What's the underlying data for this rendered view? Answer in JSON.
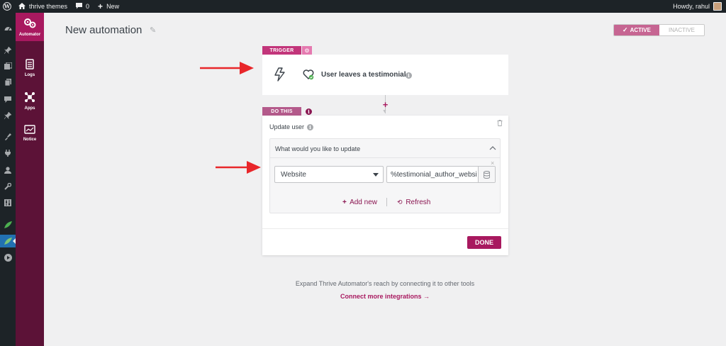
{
  "adminbar": {
    "site_name": "thrive themes",
    "comments_count": "0",
    "new_label": "New",
    "howdy": "Howdy, rahul"
  },
  "sidebar": {
    "items": [
      {
        "label": "Automator",
        "icon": "automator-icon"
      },
      {
        "label": "Logs",
        "icon": "logs-icon"
      },
      {
        "label": "Apps",
        "icon": "apps-icon"
      },
      {
        "label": "Notice",
        "icon": "notice-icon"
      }
    ]
  },
  "header": {
    "title": "New automation",
    "status_active": "ACTIVE",
    "status_inactive": "INACTIVE"
  },
  "trigger": {
    "badge": "TRIGGER",
    "label": "User leaves a testimonial"
  },
  "action": {
    "badge": "DO THIS",
    "name": "Update user",
    "panel_title": "What would you like to update",
    "field_select": "Website",
    "field_value": "%testimonial_author_website%",
    "add_new": "Add new",
    "refresh": "Refresh",
    "done": "DONE"
  },
  "footer": {
    "expand_text": "Expand Thrive Automator's reach by connecting it to other tools",
    "connect_link": "Connect more integrations →"
  },
  "colors": {
    "brand": "#a8195f",
    "sidebar_bg": "#5c1237",
    "active_toggle": "#c66592",
    "annotation_arrow": "#e8262a"
  }
}
